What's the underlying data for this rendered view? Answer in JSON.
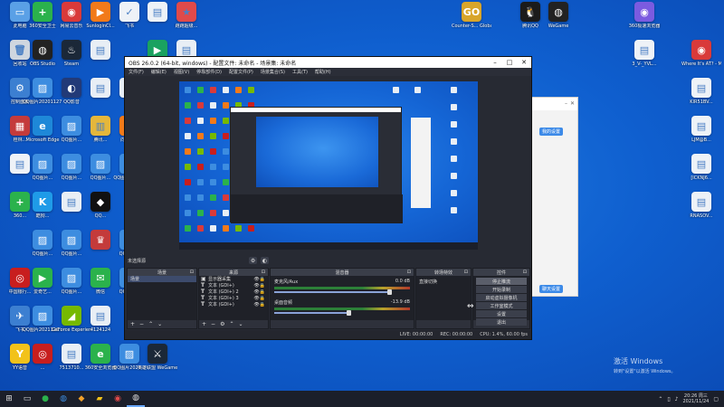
{
  "desktop_icons": [
    {
      "id": "i1",
      "label": "此电脑",
      "color": "#5aa0e6",
      "glyph": "▭"
    },
    {
      "id": "i2",
      "label": "360安全卫士",
      "color": "#2bb24c",
      "glyph": "+"
    },
    {
      "id": "i3",
      "label": "网易云音乐",
      "color": "#d93a3a",
      "glyph": "◉"
    },
    {
      "id": "i4",
      "label": "SunloginCl...",
      "color": "#f27a1a",
      "glyph": "▶"
    },
    {
      "id": "i5",
      "label": "飞书",
      "color": "#eef2f7",
      "glyph": "✓"
    },
    {
      "id": "i6",
      "label": "",
      "color": "#eef2f7",
      "glyph": "▤"
    },
    {
      "id": "i7",
      "label": "跑跑超级...",
      "color": "#e04a4a",
      "glyph": "★"
    },
    {
      "id": "i8",
      "label": "回收站",
      "color": "#cfd6df",
      "glyph": "🗑"
    },
    {
      "id": "i9",
      "label": "OBS Studio",
      "color": "#222222",
      "glyph": "◍"
    },
    {
      "id": "i10",
      "label": "Steam",
      "color": "#1b2838",
      "glyph": "♨"
    },
    {
      "id": "i11",
      "label": "",
      "color": "#e8eef5",
      "glyph": "▤"
    },
    {
      "id": "i12",
      "label": "",
      "color": "#1aa260",
      "glyph": "▶"
    },
    {
      "id": "i13",
      "label": "腾讯视频...",
      "color": "#e8eef5",
      "glyph": "▤"
    },
    {
      "id": "i14",
      "label": "控制面板",
      "color": "#3c7fd1",
      "glyph": "⚙"
    },
    {
      "id": "i15",
      "label": "QQ图片20201127...",
      "color": "#3d8de0",
      "glyph": "▨"
    },
    {
      "id": "i16",
      "label": "QQ影音",
      "color": "#223a78",
      "glyph": "◐"
    },
    {
      "id": "i17",
      "label": "",
      "color": "#e8eef5",
      "glyph": "▤"
    },
    {
      "id": "i18",
      "label": "",
      "color": "#e8eef5",
      "glyph": "▤"
    },
    {
      "id": "i19",
      "label": "桂林...",
      "color": "#c43b3b",
      "glyph": "▦"
    },
    {
      "id": "i20",
      "label": "Microsoft Edge",
      "color": "#1e88d8",
      "glyph": "e"
    },
    {
      "id": "i21",
      "label": "QQ图片...",
      "color": "#3d8de0",
      "glyph": "▨"
    },
    {
      "id": "i22",
      "label": "腾讯...",
      "color": "#e5b73b",
      "glyph": "▥"
    },
    {
      "id": "i23",
      "label": "向日葵...",
      "color": "#f27a1a",
      "glyph": "✿"
    },
    {
      "id": "i24",
      "label": "",
      "color": "#eef2f7",
      "glyph": "▤"
    },
    {
      "id": "i25",
      "label": "QQ图片...",
      "color": "#3d8de0",
      "glyph": "▨"
    },
    {
      "id": "i26",
      "label": "QQ图片...",
      "color": "#3d8de0",
      "glyph": "▨"
    },
    {
      "id": "i27",
      "label": "QQ图片...",
      "color": "#3d8de0",
      "glyph": "▨"
    },
    {
      "id": "i28",
      "label": "QQ图片2021...",
      "color": "#3d8de0",
      "glyph": "▨"
    },
    {
      "id": "i29",
      "label": "360...",
      "color": "#2bb24c",
      "glyph": "+"
    },
    {
      "id": "i30",
      "label": "酷狗...",
      "color": "#1f9be8",
      "glyph": "K"
    },
    {
      "id": "i31",
      "label": "",
      "color": "#e8eef5",
      "glyph": "▤"
    },
    {
      "id": "i32",
      "label": "QQ...",
      "color": "#111111",
      "glyph": "◆"
    },
    {
      "id": "i33",
      "label": "QQ图片...",
      "color": "#3d8de0",
      "glyph": "▨"
    },
    {
      "id": "i34",
      "label": "QQ图片...",
      "color": "#3d8de0",
      "glyph": "▨"
    },
    {
      "id": "i35",
      "label": "",
      "color": "#c43b3b",
      "glyph": "♛"
    },
    {
      "id": "i36",
      "label": "中国银行...",
      "color": "#c81e1e",
      "glyph": "◎"
    },
    {
      "id": "i37",
      "label": "爱奇艺...",
      "color": "#2bb24c",
      "glyph": "▶"
    },
    {
      "id": "i38",
      "label": "QQ图片...",
      "color": "#3d8de0",
      "glyph": "▨"
    },
    {
      "id": "i39",
      "label": "微信",
      "color": "#2bb24c",
      "glyph": "✉"
    },
    {
      "id": "i40",
      "label": "QQ图片...",
      "color": "#3d8de0",
      "glyph": "▨"
    },
    {
      "id": "i41",
      "label": "飞书",
      "color": "#3c7fd1",
      "glyph": "✈"
    },
    {
      "id": "i42",
      "label": "QQ图片2021120...",
      "color": "#3d8de0",
      "glyph": "▨"
    },
    {
      "id": "i43",
      "label": "GeForce Experience",
      "color": "#76b900",
      "glyph": "◢"
    },
    {
      "id": "i44",
      "label": "4124124",
      "color": "#e8eef5",
      "glyph": "▤"
    },
    {
      "id": "i45",
      "label": "QQ图片...",
      "color": "#3d8de0",
      "glyph": "▨"
    },
    {
      "id": "i46",
      "label": "YY语音",
      "color": "#f2c21a",
      "glyph": "Y"
    },
    {
      "id": "i47",
      "label": "...",
      "color": "#c81e1e",
      "glyph": "◎"
    },
    {
      "id": "i48",
      "label": "7513710...",
      "color": "#e8eef5",
      "glyph": "▤"
    },
    {
      "id": "i49",
      "label": "360安全浏览器",
      "color": "#2bb24c",
      "glyph": "e"
    },
    {
      "id": "i50",
      "label": "QQ图片2021...",
      "color": "#3d8de0",
      "glyph": "▨"
    },
    {
      "id": "i51",
      "label": "英雄联盟 WeGame版",
      "color": "#1b2838",
      "glyph": "⚔"
    },
    {
      "id": "i52",
      "label": "Counter-S... Global Off...",
      "color": "#d8a52a",
      "glyph": "GO"
    },
    {
      "id": "i53",
      "label": "腾讯QQ",
      "color": "#1b1b1b",
      "glyph": "🐧"
    },
    {
      "id": "i54",
      "label": "WeGame",
      "color": "#222222",
      "glyph": "◍"
    },
    {
      "id": "i55",
      "label": "360极速浏览器",
      "color": "#7b5be0",
      "glyph": "◉"
    },
    {
      "id": "i56",
      "label": "3_V-_YVL...",
      "color": "#eef2f7",
      "glyph": "▤"
    },
    {
      "id": "i57",
      "label": "Where It's AT? - Mid...",
      "color": "#d93a3a",
      "glyph": "◉"
    },
    {
      "id": "i58",
      "label": "KIR51BV...",
      "color": "#eef2f7",
      "glyph": "▤"
    },
    {
      "id": "i59",
      "label": "LJM@B...",
      "color": "#eef2f7",
      "glyph": "▤"
    },
    {
      "id": "i60",
      "label": "[ICKNJ6...",
      "color": "#eef2f7",
      "glyph": "▤"
    },
    {
      "id": "i61",
      "label": "RNASOV...",
      "color": "#eef2f7",
      "glyph": "▤"
    }
  ],
  "obs": {
    "title": "OBS 26.0.2 (64-bit, windows) - 配置文件: 未命名 - 场景集: 未命名",
    "menu": [
      "文件(F)",
      "编辑(E)",
      "视图(V)",
      "停靠部件(D)",
      "配置文件(P)",
      "场景集合(S)",
      "工具(T)",
      "帮助(H)"
    ],
    "scene_label": "未选择源",
    "docks": {
      "scenes": {
        "title": "场景",
        "items": [
          "场景"
        ]
      },
      "sources": {
        "title": "来源",
        "items": [
          "显示器采集",
          "文本 (GDI+)",
          "文本 (GDI+) 2",
          "文本 (GDI+) 3",
          "文本 (GDI+)"
        ]
      },
      "mixer": {
        "title": "混音器",
        "channels": [
          {
            "name": "麦克风/Aux",
            "db": "0.0 dB"
          },
          {
            "name": "桌面音频",
            "db": "-13.9 dB"
          }
        ]
      },
      "transitions": {
        "title": "转场特效",
        "value": "直接切换"
      },
      "controls": {
        "title": "控件",
        "buttons": [
          "停止推流",
          "开始录制",
          "启动虚拟摄像机",
          "工作室模式",
          "设置",
          "退出"
        ]
      }
    },
    "status": {
      "live": "LIVE: 00:00:00",
      "rec": "REC: 00:00:00",
      "cpu": "CPU: 1.4%, 60.00 fps"
    }
  },
  "chat": {
    "btn1": "我的设置",
    "btn2": "聊天设置"
  },
  "activate": {
    "line1": "激活 Windows",
    "line2": "转到\"设置\"以激活 Windows。"
  },
  "taskbar": {
    "time": "20:26 周三",
    "date": "2021/11/24"
  }
}
